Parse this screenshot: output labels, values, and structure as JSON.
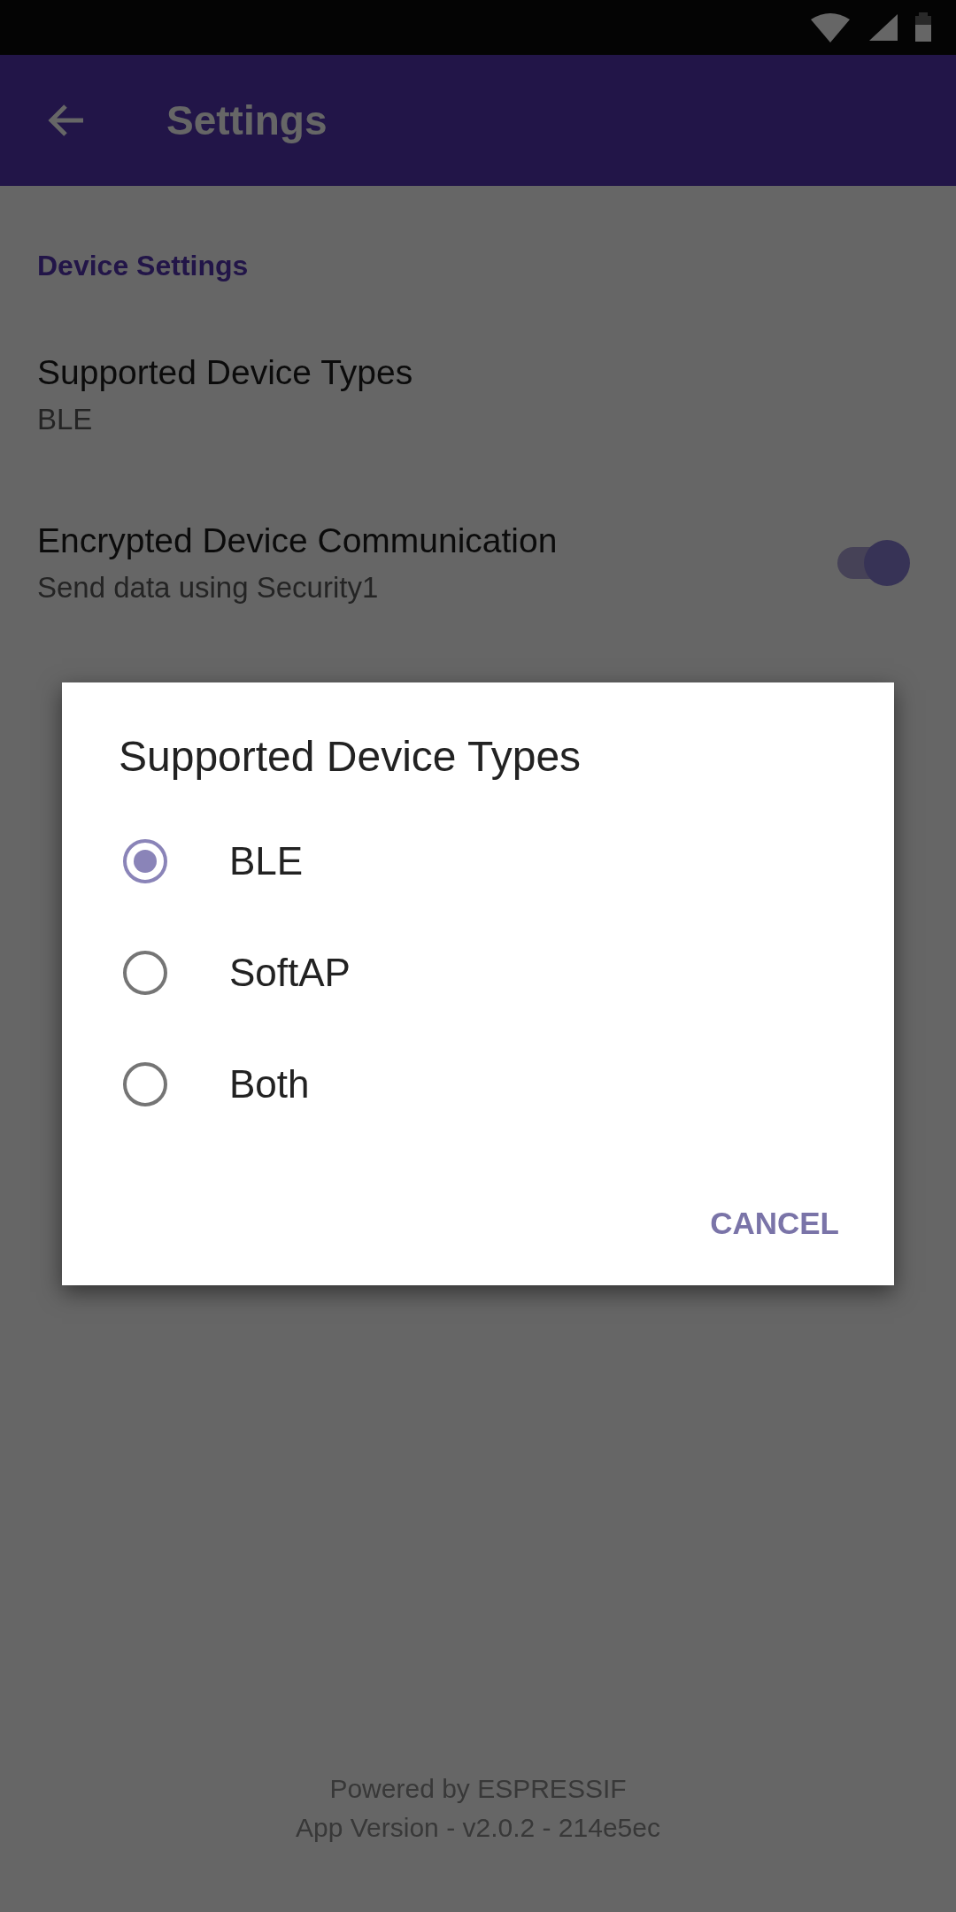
{
  "app_bar": {
    "title": "Settings"
  },
  "section": {
    "title": "Device Settings"
  },
  "settings": [
    {
      "kind": "value",
      "title": "Supported Device Types",
      "summary": "BLE"
    },
    {
      "kind": "switch",
      "title": "Encrypted Device Communication",
      "summary": "Send data using Security1",
      "on": true
    }
  ],
  "dialog": {
    "title": "Supported Device Types",
    "options": [
      {
        "label": "BLE",
        "selected": true
      },
      {
        "label": "SoftAP",
        "selected": false
      },
      {
        "label": "Both",
        "selected": false
      }
    ],
    "buttons": [
      "CANCEL"
    ]
  },
  "footer": [
    "Powered by ESPRESSIF",
    "App Version - v2.0.2 - 214e5ec"
  ]
}
